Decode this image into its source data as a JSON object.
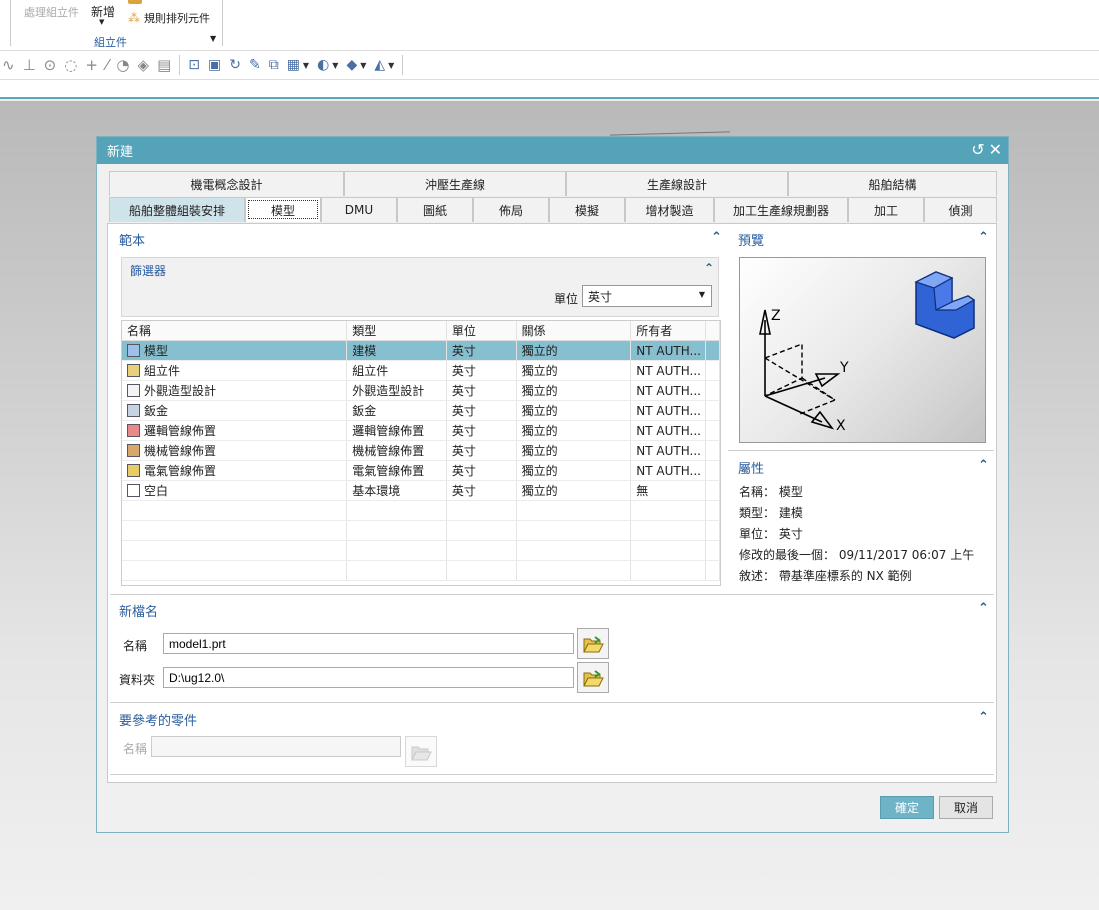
{
  "ribbon": {
    "assembly_ops": "處理組立件",
    "new": "新增",
    "pattern_component": "規則排列元件",
    "group": "組立件"
  },
  "dialog": {
    "title": "新建",
    "tabs_row1": [
      "機電概念設計",
      "沖壓生產線",
      "生產線設計",
      "船舶結構"
    ],
    "tabs_row2": [
      "船舶整體組裝安排",
      "模型",
      "DMU",
      "圖紙",
      "佈局",
      "模擬",
      "增材製造",
      "加工生產線規劃器",
      "加工",
      "偵測"
    ],
    "templates": {
      "title": "範本",
      "filter_title": "篩選器",
      "unit_label": "單位",
      "unit_value": "英寸",
      "columns": [
        "名稱",
        "類型",
        "單位",
        "關係",
        "所有者"
      ],
      "rows": [
        {
          "name": "模型",
          "type": "建模",
          "unit": "英寸",
          "relation": "獨立的",
          "owner": "NT AUTH..."
        },
        {
          "name": "組立件",
          "type": "組立件",
          "unit": "英寸",
          "relation": "獨立的",
          "owner": "NT AUTH..."
        },
        {
          "name": "外觀造型設計",
          "type": "外觀造型設計",
          "unit": "英寸",
          "relation": "獨立的",
          "owner": "NT AUTH..."
        },
        {
          "name": "鈑金",
          "type": "鈑金",
          "unit": "英寸",
          "relation": "獨立的",
          "owner": "NT AUTH..."
        },
        {
          "name": "邏輯管線佈置",
          "type": "邏輯管線佈置",
          "unit": "英寸",
          "relation": "獨立的",
          "owner": "NT AUTH..."
        },
        {
          "name": "機械管線佈置",
          "type": "機械管線佈置",
          "unit": "英寸",
          "relation": "獨立的",
          "owner": "NT AUTH..."
        },
        {
          "name": "電氣管線佈置",
          "type": "電氣管線佈置",
          "unit": "英寸",
          "relation": "獨立的",
          "owner": "NT AUTH..."
        },
        {
          "name": "空白",
          "type": "基本環境",
          "unit": "英寸",
          "relation": "獨立的",
          "owner": "無"
        }
      ]
    },
    "preview": {
      "title": "預覽",
      "axis_x": "X",
      "axis_y": "Y",
      "axis_z": "Z"
    },
    "properties": {
      "title": "屬性",
      "name_line": "名稱： 模型",
      "type_line": "類型： 建模",
      "unit_line": "單位： 英寸",
      "modified_line": "修改的最後一個： 09/11/2017 06:07 上午",
      "desc_line": "敘述： 帶基準座標系的 NX 範例"
    },
    "new_filename": {
      "title": "新檔名",
      "name_label": "名稱",
      "name_value": "model1.prt",
      "folder_label": "資料夾",
      "folder_value": "D:\\ug12.0\\"
    },
    "reference_part": {
      "title": "要參考的零件",
      "name_label": "名稱",
      "name_value": ""
    },
    "ok": "確定",
    "cancel": "取消"
  },
  "colors": {
    "titlebar": "#55a3b9",
    "selected_row": "#86c0d0",
    "ok_button": "#6fb3c7",
    "section_title": "#2a5d9e"
  }
}
